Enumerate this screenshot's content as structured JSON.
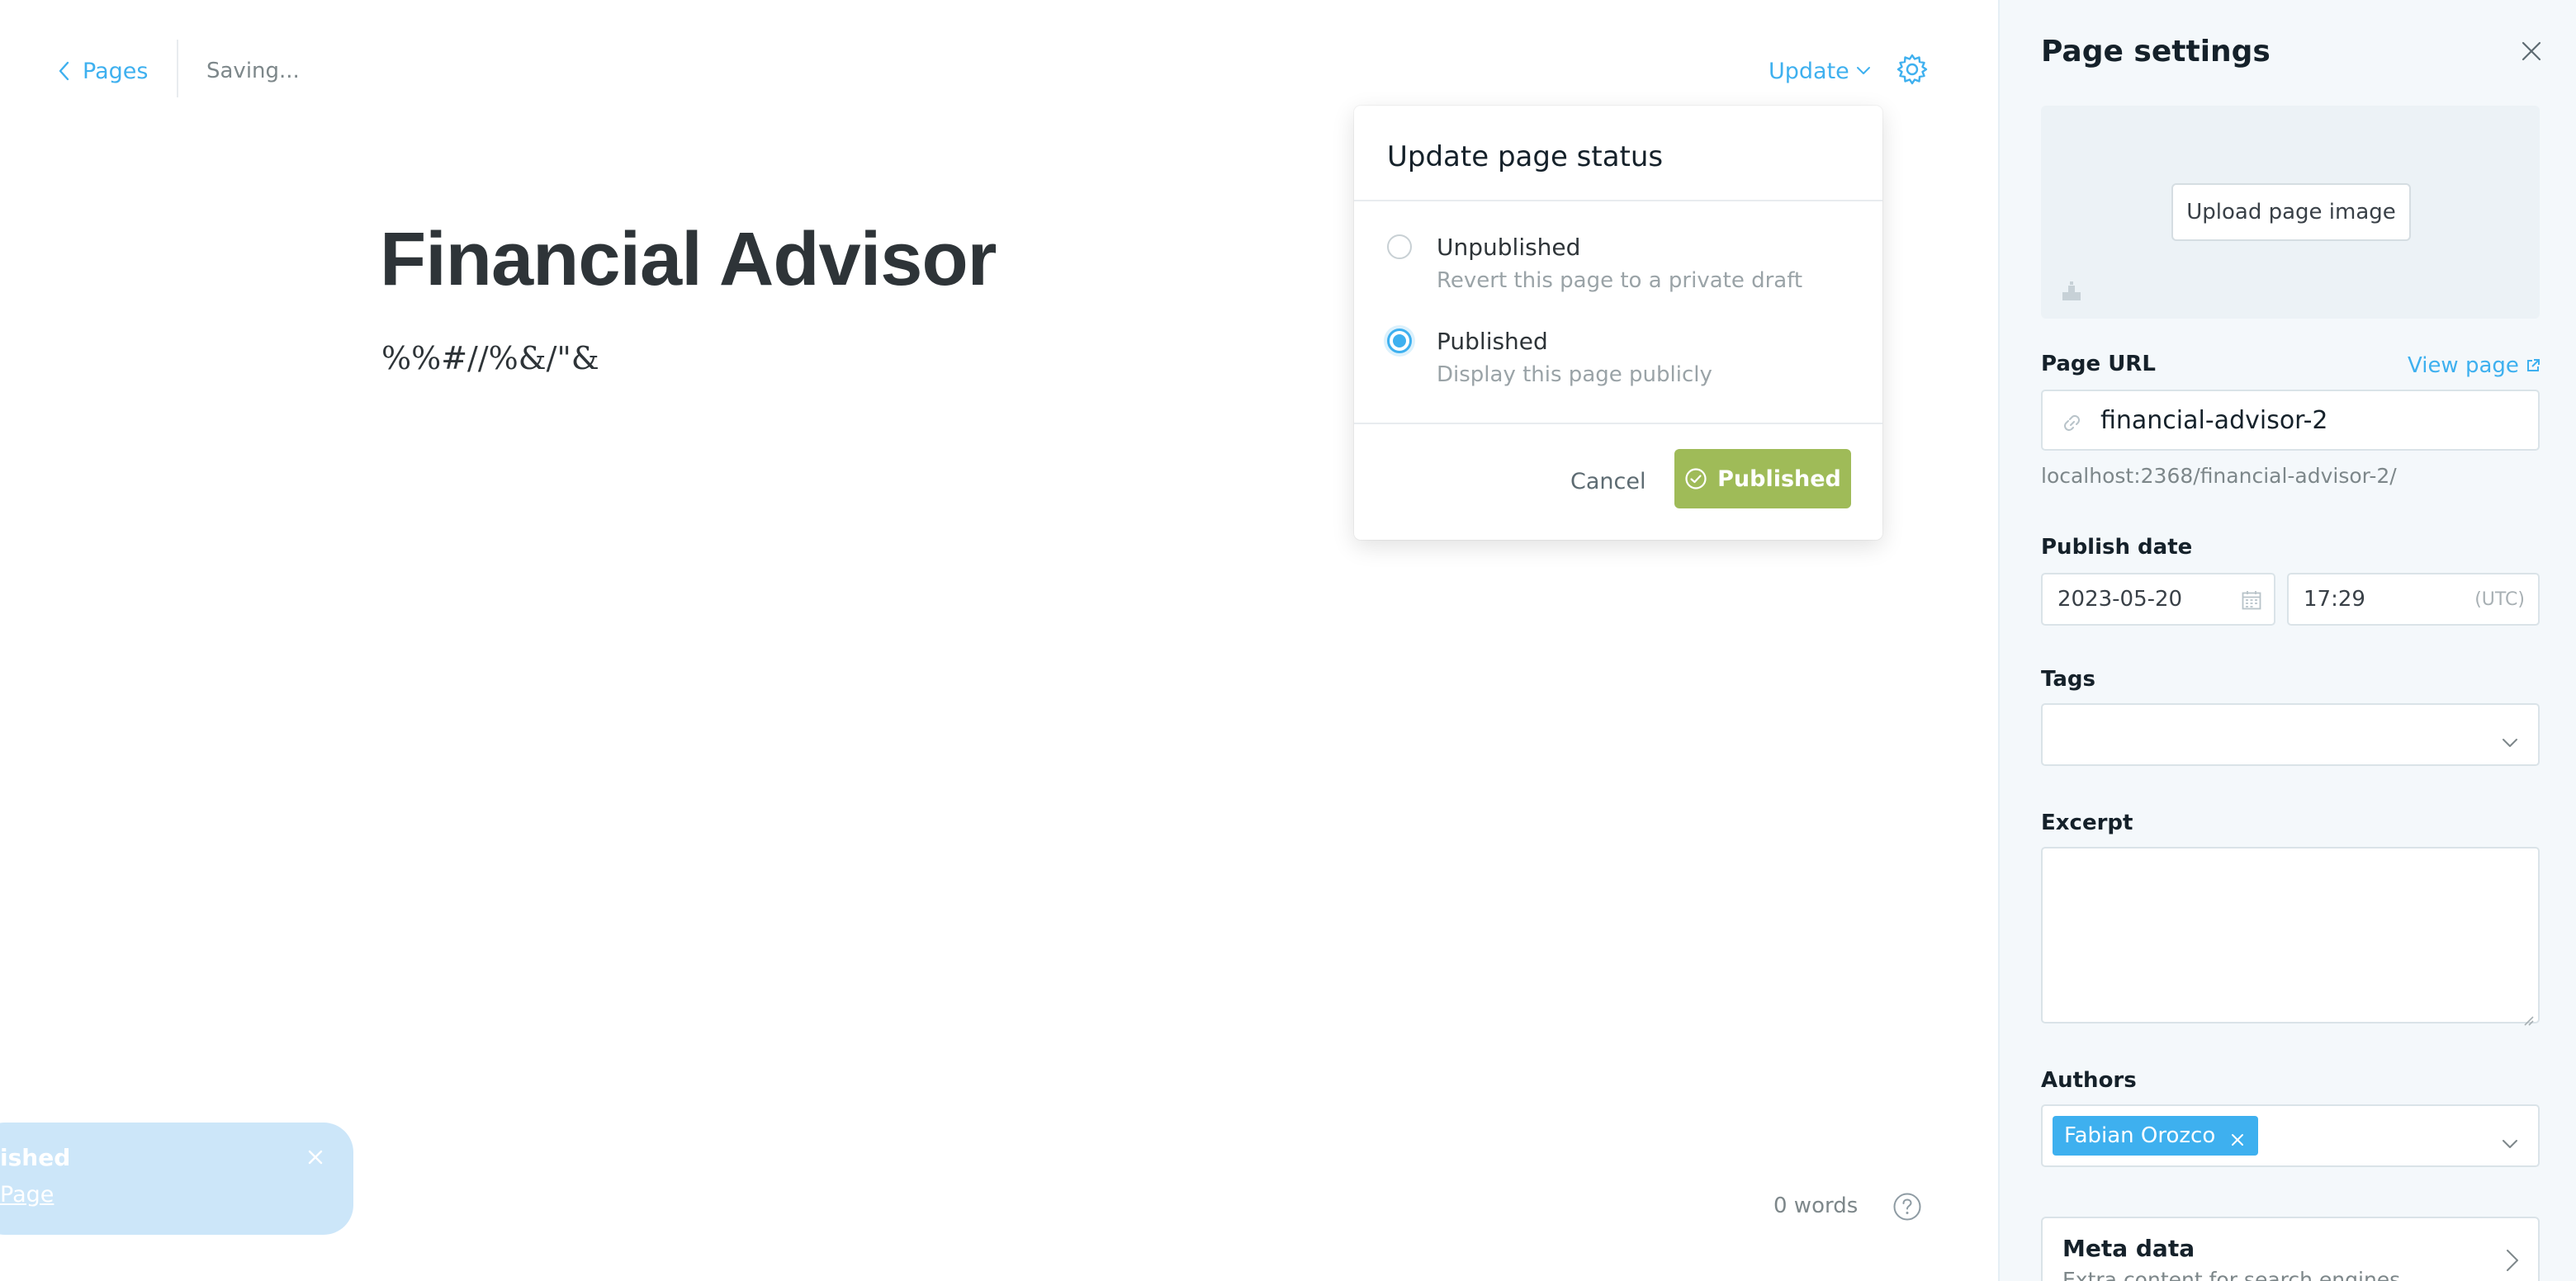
{
  "header": {
    "back_label": "Pages",
    "status_text": "Saving...",
    "update_label": "Update"
  },
  "editor": {
    "title": "Financial Advisor",
    "body": "%%#//%&/\"&",
    "word_count": "0 words"
  },
  "toast": {
    "title_fragment": "ished",
    "link_fragment": "Page"
  },
  "status_popover": {
    "title": "Update page status",
    "options": [
      {
        "title": "Unpublished",
        "description": "Revert this page to a private draft",
        "selected": false
      },
      {
        "title": "Published",
        "description": "Display this page publicly",
        "selected": true
      }
    ],
    "cancel_label": "Cancel",
    "confirm_label": "Published"
  },
  "settings": {
    "title": "Page settings",
    "upload_image_label": "Upload page image",
    "page_url_label": "Page URL",
    "view_page_label": "View page",
    "url_value": "financial-advisor-2",
    "url_preview": "localhost:2368/financial-advisor-2/",
    "publish_date_label": "Publish date",
    "date_value": "2023-05-20",
    "time_value": "17:29",
    "timezone": "(UTC)",
    "tags_label": "Tags",
    "excerpt_label": "Excerpt",
    "authors_label": "Authors",
    "authors": [
      "Fabian Orozco"
    ],
    "meta_data": {
      "title": "Meta data",
      "subtitle": "Extra content for search engines"
    }
  },
  "colors": {
    "accent": "#3eb0ef",
    "published_green": "#9fbb58",
    "sidebar_bg": "#f4f8fb",
    "toast_bg": "#cce6f9"
  }
}
